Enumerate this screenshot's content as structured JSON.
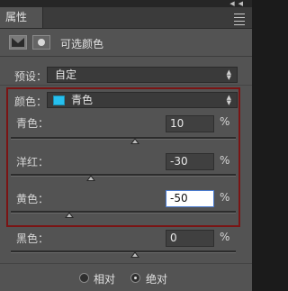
{
  "panel": {
    "tab_title": "属性",
    "header_title": "可选颜色"
  },
  "preset": {
    "label": "预设：",
    "value": "自定"
  },
  "color": {
    "label": "颜色：",
    "value": "青色",
    "swatch_color": "#26c0ef"
  },
  "sliders": [
    {
      "label": "青色：",
      "value": "10",
      "unit": "%",
      "percent": 10
    },
    {
      "label": "洋红：",
      "value": "-30",
      "unit": "%",
      "percent": -30
    },
    {
      "label": "黄色：",
      "value": "-50",
      "unit": "%",
      "percent": -50,
      "focused": true
    },
    {
      "label": "黑色：",
      "value": "0",
      "unit": "%",
      "percent": 0
    }
  ],
  "method": {
    "options": [
      "相对",
      "绝对"
    ],
    "selected": "绝对"
  },
  "highlight_color": "#7a1414"
}
